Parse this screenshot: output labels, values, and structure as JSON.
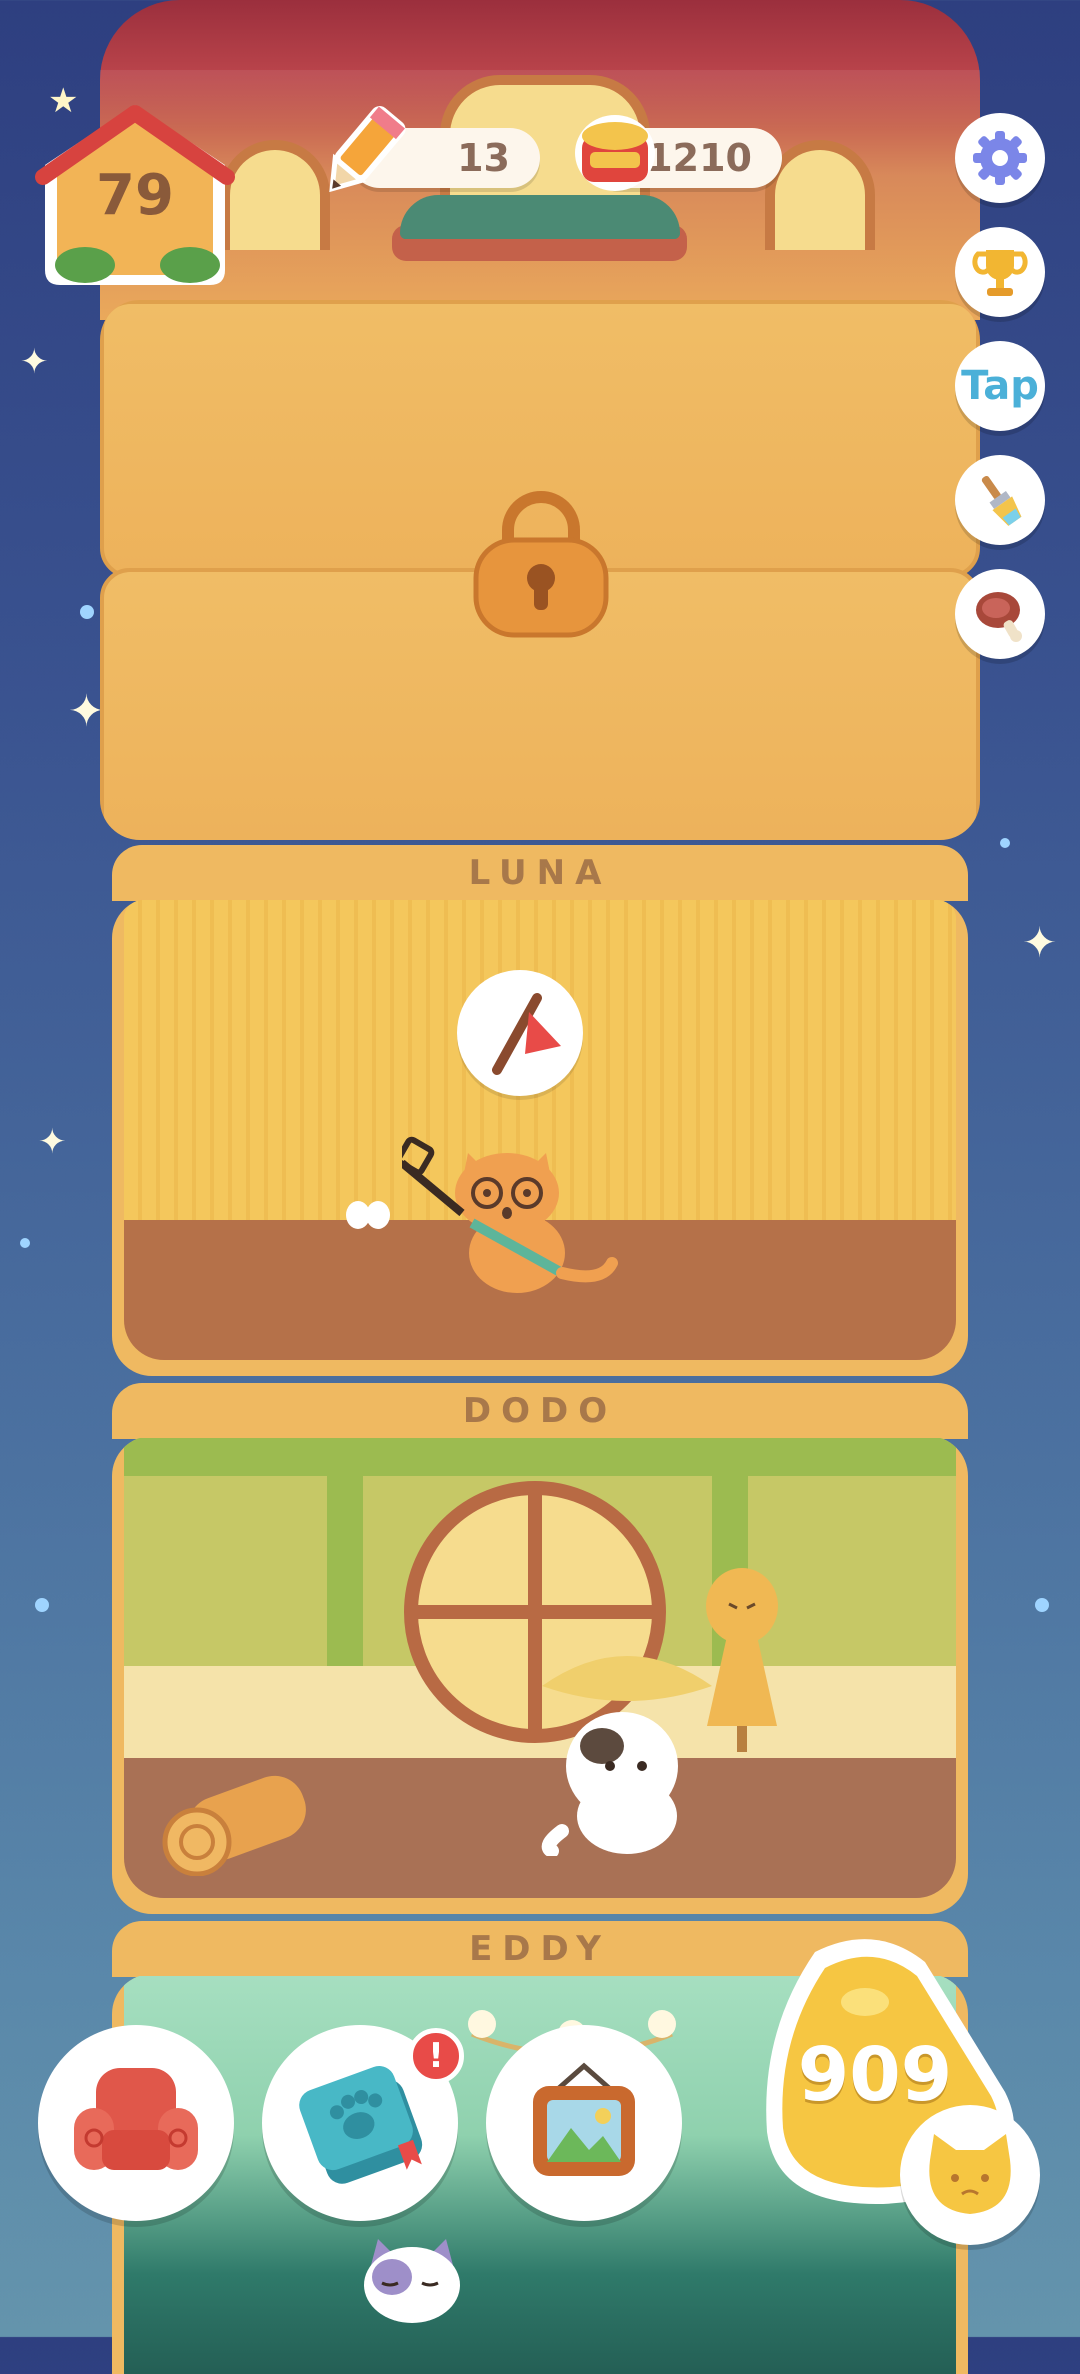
{
  "house_level": "79",
  "currencies": {
    "pencils": "13",
    "cans": "1210"
  },
  "side_buttons": [
    {
      "name": "settings",
      "icon": "gear-icon",
      "label": ""
    },
    {
      "name": "achievements",
      "icon": "trophy-icon",
      "label": ""
    },
    {
      "name": "tap",
      "icon": "tap-text-icon",
      "label": "Tap"
    },
    {
      "name": "paint",
      "icon": "paintbrush-icon",
      "label": ""
    },
    {
      "name": "food",
      "icon": "meat-icon",
      "label": ""
    }
  ],
  "floors": [
    {
      "id": "locked",
      "locked": true,
      "name": ""
    },
    {
      "id": "luna",
      "name": "LUNA",
      "wall_color": "#f4c75c",
      "floor_color": "#b57149",
      "speech_icon": "cat-toy-icon"
    },
    {
      "id": "dodo",
      "name": "DODO",
      "wall_color": "#c6c866",
      "floor_color": "#a97155"
    },
    {
      "id": "eddy",
      "name": "EDDY",
      "wall_color": "#a6dfc0",
      "floor_color": "#2f7a6a"
    }
  ],
  "bottom_bar": {
    "furniture": {
      "icon": "armchair-icon"
    },
    "catbook": {
      "icon": "paw-notebook-icon",
      "badge": "!"
    },
    "gallery": {
      "icon": "picture-frame-icon"
    },
    "fish_counter": {
      "value": "909",
      "icon": "cat-face-icon"
    }
  },
  "colors": {
    "accent_orange": "#efb961",
    "roof_red": "#b8434a",
    "badge_red": "#e84b48",
    "counter_yellow": "#f6c642"
  }
}
